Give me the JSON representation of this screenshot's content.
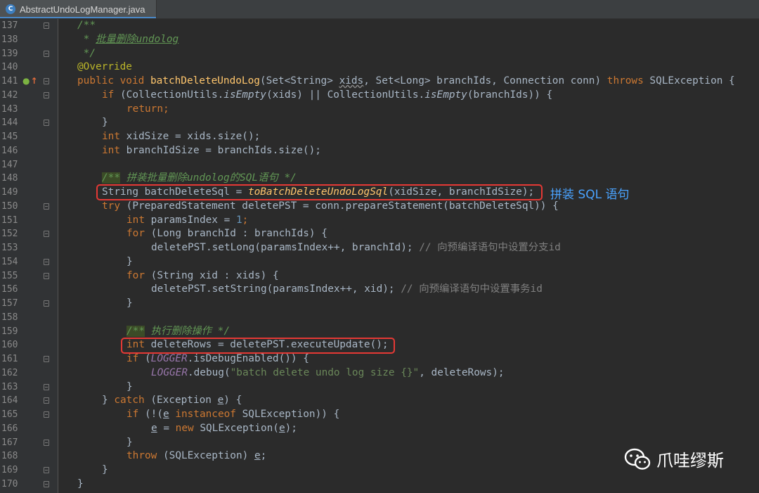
{
  "tab": {
    "icon": "C",
    "label": "AbstractUndoLogManager.java"
  },
  "line_numbers": [
    "137",
    "138",
    "139",
    "140",
    "141",
    "142",
    "143",
    "144",
    "145",
    "146",
    "147",
    "148",
    "149",
    "150",
    "151",
    "152",
    "153",
    "154",
    "155",
    "156",
    "157",
    "158",
    "159",
    "160",
    "161",
    "162",
    "163",
    "164",
    "165",
    "166",
    "167",
    "168",
    "169",
    "170"
  ],
  "code": {
    "c137": "/**",
    "c138a": " * ",
    "c138b": "批量删除undolog",
    "c139": " */",
    "c140": "@Override",
    "c141_public": "public",
    "c141_void": " void ",
    "c141_name": "batchDeleteUndoLog",
    "c141_p1": "(Set<String> ",
    "c141_xids": "xids",
    "c141_p2": ", Set<Long> branchIds, Connection conn) ",
    "c141_throws": "throws",
    "c141_p3": " SQLException {",
    "c142_if": "if",
    "c142_a": " (CollectionUtils.",
    "c142_b": "isEmpty",
    "c142_c": "(xids) || CollectionUtils.",
    "c142_d": "isEmpty",
    "c142_e": "(branchIds)) {",
    "c143_ret": "return",
    "c143_b": ";",
    "c144": "}",
    "c145_int": "int",
    "c145_b": " xidSize = xids.size();",
    "c146_int": "int",
    "c146_b": " branchIdSize = branchIds.size();",
    "c148a": "/**",
    "c148b": " 拼装批量删除undolog的SQL语句 */",
    "c149a": "String batchDeleteSql = ",
    "c149b": "toBatchDeleteUndoLogSql",
    "c149c": "(xidSize, branchIdSize);",
    "c150_try": "try",
    "c150_b": " (PreparedStatement deletePST = conn.prepareStatement(batchDeleteSql)) {",
    "c151_int": "int",
    "c151_b": " paramsIndex = ",
    "c151_n": "1",
    "c151_c": ";",
    "c152_for": "for",
    "c152_b": " (Long branchId : branchIds) {",
    "c153_a": "deletePST.setLong(paramsIndex++, branchId); ",
    "c153_cm": "// 向预编译语句中设置分支id",
    "c154": "}",
    "c155_for": "for",
    "c155_b": " (String xid : xids) {",
    "c156_a": "deletePST.setString(paramsIndex++, xid); ",
    "c156_cm": "// 向预编译语句中设置事务id",
    "c157": "}",
    "c159a": "/**",
    "c159b": " 执行删除操作 */",
    "c160_int": "int",
    "c160_b": " deleteRows = deletePST.executeUpdate();",
    "c161_if": "if",
    "c161_a": " (",
    "c161_b": "LOGGER",
    "c161_c": ".isDebugEnabled()) {",
    "c162_a": "LOGGER",
    "c162_b": ".debug(",
    "c162_s": "\"batch delete undo log size {}\"",
    "c162_c": ", deleteRows);",
    "c163": "}",
    "c164_a": "} ",
    "c164_catch": "catch",
    "c164_b": " (Exception ",
    "c164_e": "e",
    "c164_c": ") {",
    "c165_if": "if",
    "c165_a": " (!(",
    "c165_e": "e",
    "c165_inst": " instanceof",
    "c165_b": " SQLException)) {",
    "c166_e": "e",
    "c166_a": " = ",
    "c166_new": "new",
    "c166_b": " SQLException(",
    "c166_e2": "e",
    "c166_c": ");",
    "c167": "}",
    "c168_throw": "throw",
    "c168_a": " (SQLException) ",
    "c168_e": "e",
    "c168_b": ";",
    "c169": "}",
    "c170": "}"
  },
  "annotation": {
    "callout": "拼装 SQL 语句"
  },
  "watermark": {
    "icon": "wechat-icon",
    "text": "爪哇缪斯"
  },
  "colors": {
    "keyword": "#cc7832",
    "function": "#ffc66d",
    "comment": "#629755",
    "highlight_box": "#e53935",
    "callout": "#4aa3ff"
  }
}
